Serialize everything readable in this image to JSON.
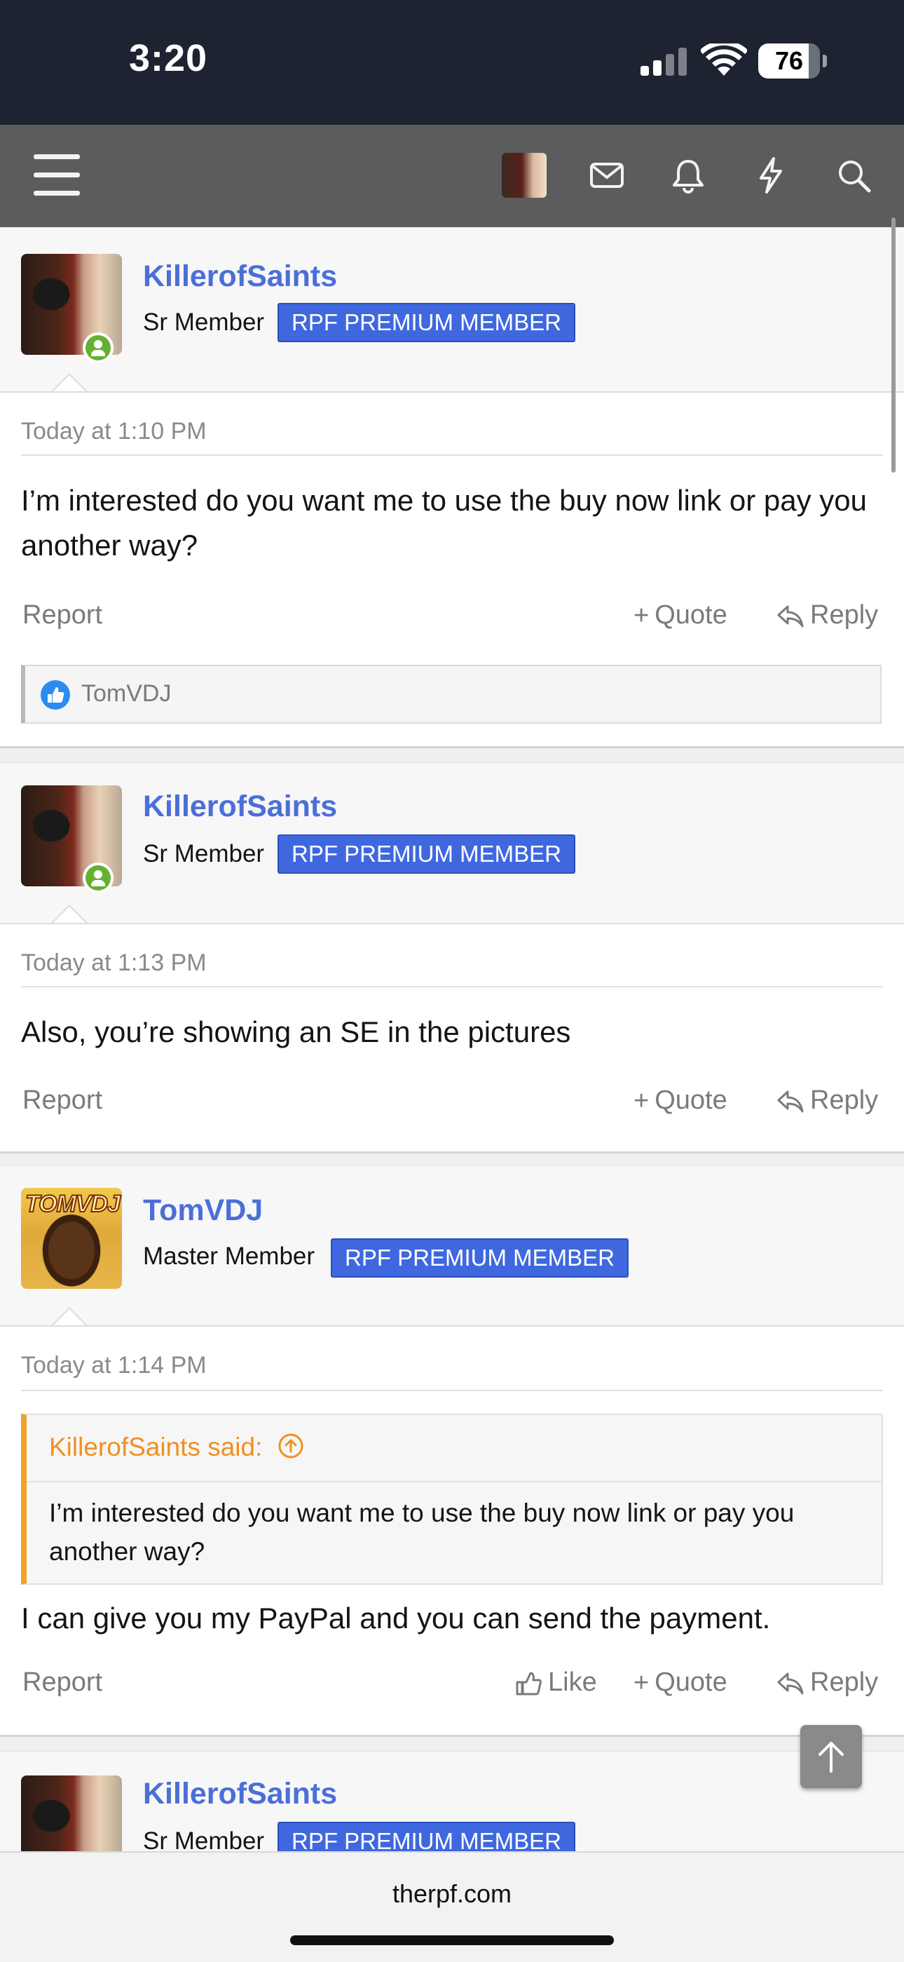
{
  "status_bar": {
    "time": "3:20",
    "battery": "76"
  },
  "nav": {
    "icons": [
      "menu-icon",
      "avatar",
      "mail-icon",
      "bell-icon",
      "lightning-icon",
      "search-icon"
    ]
  },
  "posts": [
    {
      "author": "KillerofSaints",
      "rank": "Sr Member",
      "badge": "RPF PREMIUM MEMBER",
      "timestamp": "Today at 1:10 PM",
      "message": "I’m interested do you want me to use the buy now link or pay you another way?",
      "actions": {
        "report": "Report",
        "quote": "Quote",
        "reply": "Reply"
      },
      "reactions": {
        "user": "TomVDJ"
      }
    },
    {
      "author": "KillerofSaints",
      "rank": "Sr Member",
      "badge": "RPF PREMIUM MEMBER",
      "timestamp": "Today at 1:13 PM",
      "message": "Also, you’re showing an SE in the pictures",
      "actions": {
        "report": "Report",
        "quote": "Quote",
        "reply": "Reply"
      }
    },
    {
      "author": "TomVDJ",
      "avatar_text": "TOMVDJ",
      "rank": "Master Member",
      "badge": "RPF PREMIUM MEMBER",
      "timestamp": "Today at 1:14 PM",
      "quote": {
        "header": "KillerofSaints said:",
        "text": "I’m interested do you want me to use the buy now link or pay you another way?"
      },
      "message": "I can give you my PayPal and you can send the payment.",
      "actions": {
        "report": "Report",
        "like": "Like",
        "quote": "Quote",
        "reply": "Reply"
      }
    },
    {
      "author": "KillerofSaints",
      "rank": "Sr Member",
      "badge": "RPF PREMIUM MEMBER"
    }
  ],
  "browser": {
    "url": "therpf.com"
  },
  "colors": {
    "username": "#4b6fd8",
    "badge": "#3f68df",
    "quote_accent": "#f0a12a",
    "online": "#63b132",
    "status_bar": "#1e2331",
    "nav_bar": "#5c5c5c"
  }
}
